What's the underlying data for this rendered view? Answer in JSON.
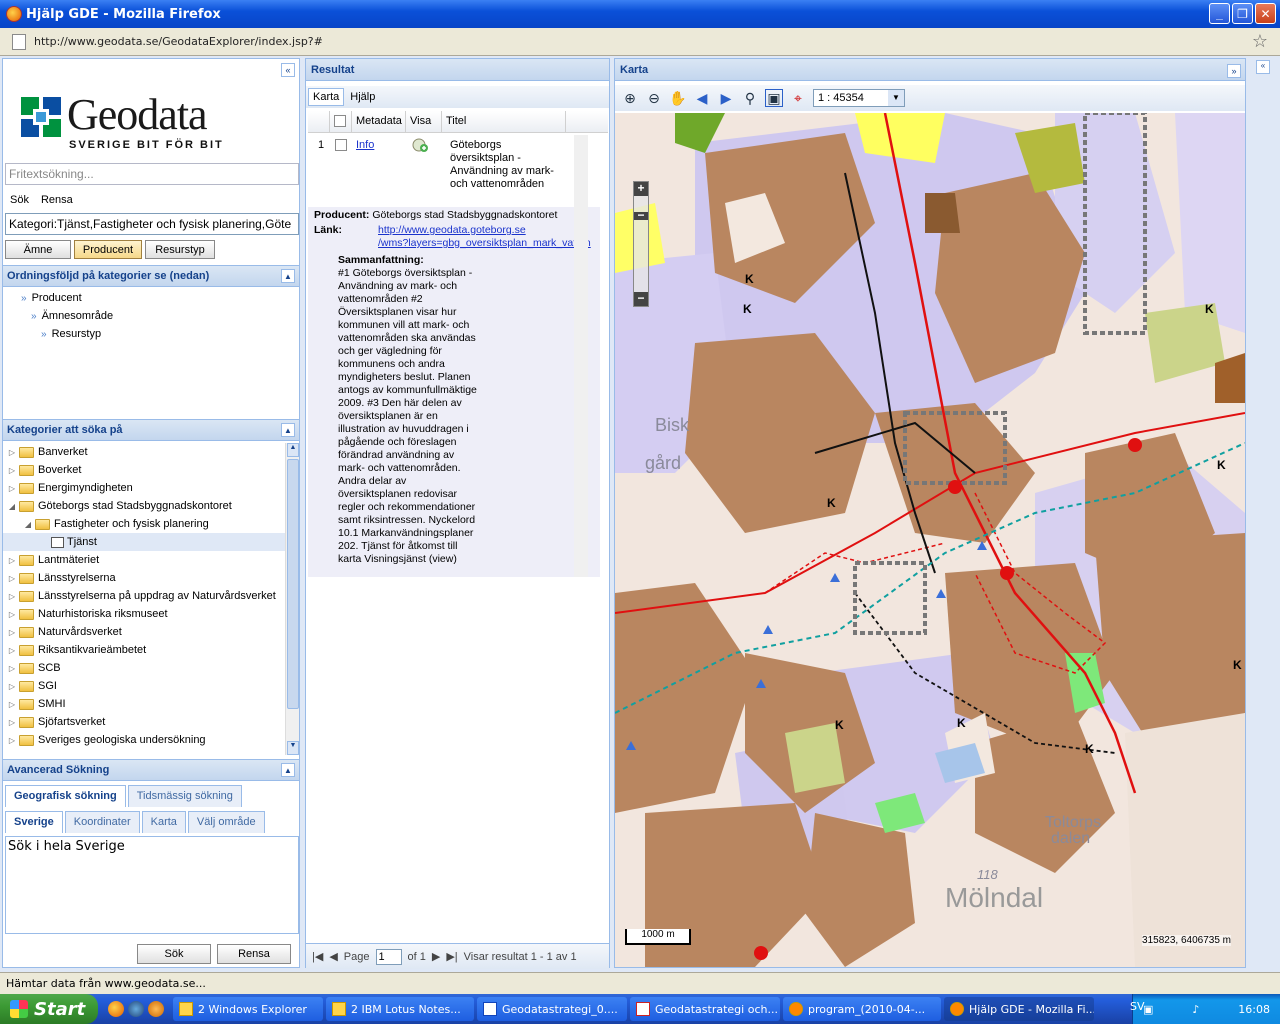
{
  "window": {
    "title": "Hjälp GDE - Mozilla Firefox",
    "url": "http://www.geodata.se/GeodataExplorer/index.jsp?#"
  },
  "left": {
    "logo_text": "Geodata",
    "logo_sub": "SVERIGE BIT FÖR BIT",
    "search_placeholder": "Fritextsökning...",
    "search_label": "Sök",
    "clear_label": "Rensa",
    "category_field": "Kategori:Tjänst,Fastigheter och fysisk planering,Göte",
    "sort_buttons": [
      "Ämne",
      "Producent",
      "Resurstyp"
    ],
    "order_header": "Ordningsföljd på kategorier se (nedan)",
    "order_items": [
      "Producent",
      "Ämnesområde",
      "Resurstyp"
    ],
    "categories_header": "Kategorier att söka på",
    "tree": [
      {
        "label": "Banverket",
        "level": 0
      },
      {
        "label": "Boverket",
        "level": 0
      },
      {
        "label": "Energimyndigheten",
        "level": 0
      },
      {
        "label": "Göteborgs stad Stadsbyggnadskontoret",
        "level": 0,
        "open": true
      },
      {
        "label": "Fastigheter och fysisk planering",
        "level": 1,
        "open": true
      },
      {
        "label": "Tjänst",
        "level": 2,
        "selected": true
      },
      {
        "label": "Lantmäteriet",
        "level": 0
      },
      {
        "label": "Länsstyrelserna",
        "level": 0
      },
      {
        "label": "Länsstyrelserna på uppdrag av Naturvårdsverket",
        "level": 0
      },
      {
        "label": "Naturhistoriska riksmuseet",
        "level": 0
      },
      {
        "label": "Naturvårdsverket",
        "level": 0
      },
      {
        "label": "Riksantikvarieämbetet",
        "level": 0
      },
      {
        "label": "SCB",
        "level": 0
      },
      {
        "label": "SGI",
        "level": 0
      },
      {
        "label": "SMHI",
        "level": 0
      },
      {
        "label": "Sjöfartsverket",
        "level": 0
      },
      {
        "label": "Sveriges geologiska undersökning",
        "level": 0
      }
    ],
    "advanced_header": "Avancerad Sökning",
    "adv_tabs": [
      "Geografisk sökning",
      "Tidsmässig sökning"
    ],
    "geo_tabs": [
      "Sverige",
      "Koordinater",
      "Karta",
      "Välj område"
    ],
    "adv_body": "Sök i hela Sverige",
    "adv_search": "Sök",
    "adv_clear": "Rensa"
  },
  "results": {
    "header": "Resultat",
    "tabs": [
      "Karta",
      "Hjälp"
    ],
    "columns": [
      "Metadata",
      "Visa",
      "Titel"
    ],
    "row": {
      "index": "1",
      "metadata": "Info",
      "title": "Göteborgs översiktsplan - Användning av mark- och vattenområden"
    },
    "producer_label": "Producent:",
    "producer": "Göteborgs stad Stadsbyggnadskontoret",
    "link_label": "Länk:",
    "link_line1": "http://www.geodata.goteborg.se",
    "link_line2": "/wms?layers=gbg_oversiktsplan_mark_vatten",
    "summary_label": "Sammanfattning:",
    "summary": "#1 Göteborgs översiktsplan - Användning av mark- och vattenområden #2 Översiktsplanen visar hur kommunen vill att mark- och vattenområden ska användas och ger vägledning för kommunens och andra myndigheters beslut. Planen antogs av kommunfullmäktige 2009. #3 Den här delen av översiktsplanen är en illustration av huvuddragen i pågående och föreslagen förändrad användning av mark- och vattenområden. Andra delar av översiktsplanen redovisar regler och rekommendationer samt riksintressen. Nyckelord 10.1 Markanvändningsplaner 202. Tjänst för åtkomst till karta Visningsjänst (view)",
    "page_label": "Page",
    "page_value": "1",
    "of_label": "of 1",
    "showing": "Visar resultat 1 - 1 av 1"
  },
  "map": {
    "header": "Karta",
    "scale": "1 : 45354",
    "scalebar": "1000 m",
    "coords": "315823, 6406735 m",
    "place_molndal": "Mölndal",
    "place_toltorp": "Toltorps",
    "place_dalen": "dalen",
    "place_bisk": "Bisk",
    "place_gard": "gård",
    "road_118": "118"
  },
  "status": "Hämtar data från www.geodata.se...",
  "taskbar": {
    "start": "Start",
    "tasks": [
      "2 Windows Explorer",
      "2 IBM Lotus Notes...",
      "Geodatastrategi_0....",
      "Geodatastrategi och...",
      "program_(2010-04-...",
      "Hjälp GDE - Mozilla Fi..."
    ],
    "lang": "SV",
    "time": "16:08"
  }
}
